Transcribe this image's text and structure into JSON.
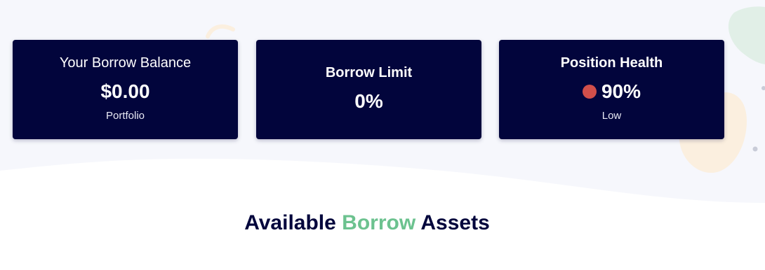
{
  "cards": {
    "borrow_balance": {
      "title": "Your Borrow Balance",
      "value": "$0.00",
      "subtitle": "Portfolio"
    },
    "borrow_limit": {
      "title": "Borrow Limit",
      "value": "0%"
    },
    "position_health": {
      "title": "Position Health",
      "value": "90%",
      "subtitle": "Low",
      "status_color": "#d14f4b"
    }
  },
  "section": {
    "title_part1": "Available",
    "title_accent": "Borrow",
    "title_part2": "Assets",
    "accent_color": "#6cc28f"
  },
  "colors": {
    "card_background": "#02053c",
    "page_band": "#f6f7fc",
    "decor_green": "#e1efe7",
    "decor_peach": "#fbefdf"
  }
}
